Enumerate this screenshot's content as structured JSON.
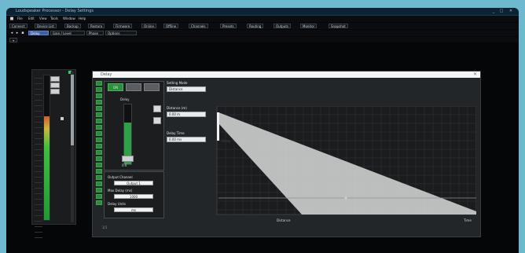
{
  "window": {
    "title": "Loudspeaker Processor - Delay Settings",
    "minimize": "_",
    "maximize": "□",
    "close": "✕"
  },
  "menu": [
    "File",
    "Edit",
    "View",
    "Tools",
    "Window",
    "Help"
  ],
  "toolbar1": {
    "items": [
      "Connect",
      "Device List",
      "Backup",
      "Restore",
      "Firmware",
      "Online",
      "Offline",
      "Channels",
      "Presets",
      "Routing",
      "Outputs",
      "Monitor",
      "Snapshot"
    ]
  },
  "toolbar2": {
    "items": [
      "Delay",
      "Gain / Level",
      "Phase",
      "Options"
    ],
    "active_index": 0
  },
  "toolbar3": {
    "item": "⇥"
  },
  "meter": {
    "level_fraction": 0.72,
    "buttons": [
      "",
      "",
      ""
    ]
  },
  "dialog": {
    "title": "Delay",
    "close": "✕",
    "header_buttons": [
      "ON",
      "",
      ""
    ],
    "active_header_index": 0,
    "fader_label": "Delay",
    "fader_level_fraction": 0.7,
    "fader_cap_label": "0.0",
    "panel_b": {
      "output_channel_label": "Output Channel",
      "output_channel_value": "Output 1",
      "max_delay_label": "Max Delay (ms)",
      "max_delay_value": "1000",
      "units_label": "Delay Units",
      "units_value": "ms"
    },
    "props": {
      "setting_mode_label": "Setting Mode",
      "setting_mode_value": "Distance",
      "distance_label": "Distance (m)",
      "distance_value": "0.00 m",
      "delay_time_label": "Delay Time",
      "delay_time_value": "0.00 ms",
      "curve_label": "Delay",
      "x_axis_label": "Distance",
      "y_axis_end_label": "Time"
    },
    "footer": "1/1"
  },
  "graph": {
    "bg_color": "#1a1c1e",
    "grid_color": "#3a3f43",
    "wedge_color": "#d9dadb",
    "line_color": "#8f9499"
  }
}
